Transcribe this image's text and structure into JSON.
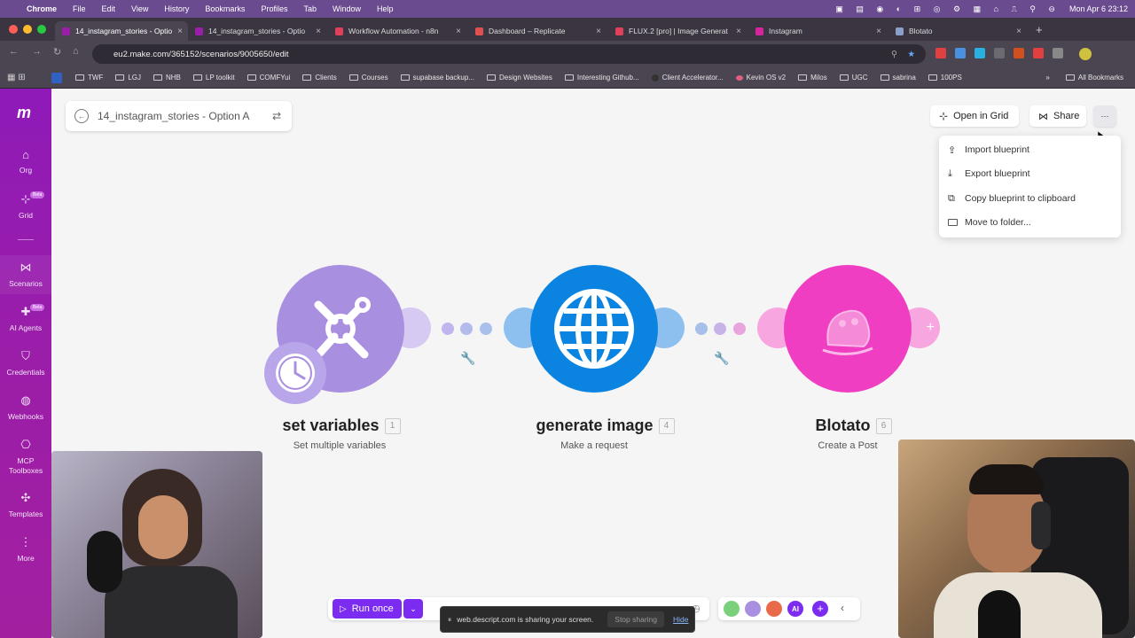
{
  "mac_menu": {
    "items": [
      "Chrome",
      "File",
      "Edit",
      "View",
      "History",
      "Bookmarks",
      "Profiles",
      "Tab",
      "Window",
      "Help"
    ],
    "datetime": "Mon Apr 6  23:12"
  },
  "tabs": [
    {
      "label": "14_instagram_stories - Optio",
      "color": "#9b1ea8",
      "active": true
    },
    {
      "label": "14_instagram_stories - Optio",
      "color": "#9b1ea8",
      "active": false
    },
    {
      "label": "Workflow Automation - n8n",
      "color": "#e0405a",
      "active": false
    },
    {
      "label": "Dashboard – Replicate",
      "color": "#e05050",
      "active": false
    },
    {
      "label": "FLUX.2 [pro] | Image Generat",
      "color": "#e0405a",
      "active": false
    },
    {
      "label": "Instagram",
      "color": "#d6249f",
      "active": false
    },
    {
      "label": "Blotato",
      "color": "#8aa0c8",
      "active": false
    }
  ],
  "address_bar": {
    "url": "eu2.make.com/365152/scenarios/9005650/edit"
  },
  "bookmarks": [
    "TWF",
    "LGJ",
    "NHB",
    "LP toolkit",
    "COMFYui",
    "Clients",
    "Courses",
    "supabase backup...",
    "Design Websites",
    "Interesting Github...",
    "Client Accelerator...",
    "Kevin OS v2",
    "Milos",
    "UGC",
    "sabrina",
    "100PS",
    "All Bookmarks"
  ],
  "sidebar": {
    "items": [
      {
        "label": "Org",
        "icon": "home-icon"
      },
      {
        "label": "Grid",
        "icon": "grid-icon",
        "badge": "Beta"
      },
      {
        "label": "Scenarios",
        "icon": "share-icon"
      },
      {
        "label": "AI Agents",
        "icon": "ai-agent-icon",
        "badge": "Beta"
      },
      {
        "label": "Credentials",
        "icon": "shield-icon"
      },
      {
        "label": "Webhooks",
        "icon": "globe-icon"
      },
      {
        "label": "MCP Toolboxes",
        "icon": "mcp-icon"
      },
      {
        "label": "Templates",
        "icon": "puzzle-icon"
      },
      {
        "label": "More",
        "icon": "more-vertical-icon"
      }
    ]
  },
  "scenario": {
    "title": "14_instagram_stories - Option A"
  },
  "toolbar": {
    "open_grid": "Open in Grid",
    "share": "Share",
    "more": "···"
  },
  "dropdown_menu": {
    "items": [
      "Import blueprint",
      "Export blueprint",
      "Copy blueprint to clipboard",
      "Move to folder..."
    ]
  },
  "nodes": [
    {
      "title": "set variables",
      "id": "1",
      "subtitle": "Set multiple variables",
      "color": "#a98fe0"
    },
    {
      "title": "generate image",
      "id": "4",
      "subtitle": "Make a request",
      "color": "#0a84e0"
    },
    {
      "title": "Blotato",
      "id": "6",
      "subtitle": "Create a Post",
      "color": "#f03ec3"
    }
  ],
  "bottom": {
    "run_once": "Run once",
    "share_notice": "web.descript.com is sharing your screen.",
    "stop_sharing": "Stop sharing",
    "hide": "Hide",
    "ai_label": "AI"
  }
}
